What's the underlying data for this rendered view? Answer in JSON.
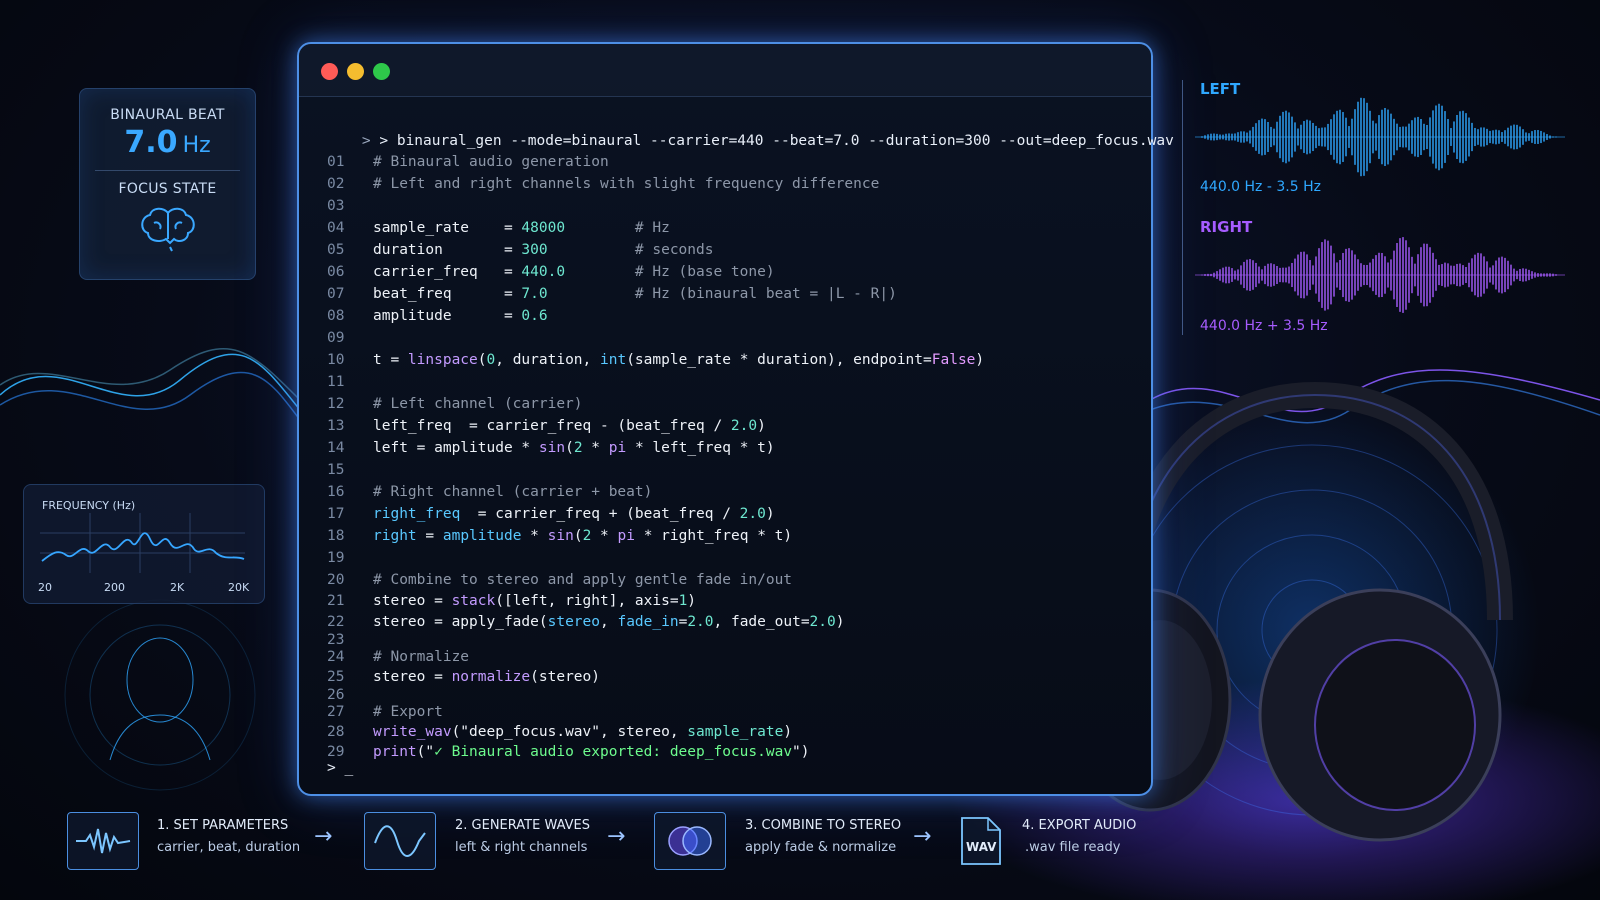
{
  "beat_card": {
    "label": "BINAURAL BEAT",
    "value": "7.0",
    "unit": "Hz",
    "state_label": "FOCUS STATE",
    "icon": "brain-icon"
  },
  "freq_card": {
    "title": "FREQUENCY (Hz)",
    "ticks": [
      "20",
      "200",
      "2K",
      "20K"
    ]
  },
  "terminal": {
    "prompt_symbol": ">",
    "command": "> binaural_gen --mode=binaural --carrier=440 --beat=7.0 --duration=300 --out=deep_focus.wav",
    "cursor_line": "> _",
    "line_numbers": [
      "01",
      "02",
      "03",
      "04",
      "05",
      "06",
      "07",
      "08",
      "09",
      "10",
      "11",
      "12",
      "13",
      "14",
      "15",
      "16",
      "17",
      "18",
      "19",
      "20",
      "21",
      "22",
      "23",
      "24",
      "25",
      "26",
      "27",
      "28",
      "29"
    ]
  },
  "channels": {
    "left_label": "LEFT",
    "left_freq": "440.0 Hz - 3.5 Hz",
    "left_color": "#2fa8ff",
    "right_label": "RIGHT",
    "right_freq": "440.0 Hz + 3.5 Hz",
    "right_color": "#a65cff"
  },
  "steps": [
    {
      "title": "1. SET PARAMETERS",
      "sub": "carrier, beat, duration",
      "icon": "waveform-icon"
    },
    {
      "title": "2. GENERATE WAVES",
      "sub": "left & right channels",
      "icon": "sine-wave-icon"
    },
    {
      "title": "3. COMBINE TO STEREO",
      "sub": "apply fade & normalize",
      "icon": "overlap-circles-icon"
    },
    {
      "title": "4. EXPORT AUDIO",
      "sub": ".wav file ready",
      "icon": "wav-file-icon",
      "file_badge": "WAV"
    }
  ],
  "colors": {
    "accent_blue": "#3aa8ff",
    "accent_purple": "#a65cff",
    "terminal_border": "#4d8fe6"
  }
}
